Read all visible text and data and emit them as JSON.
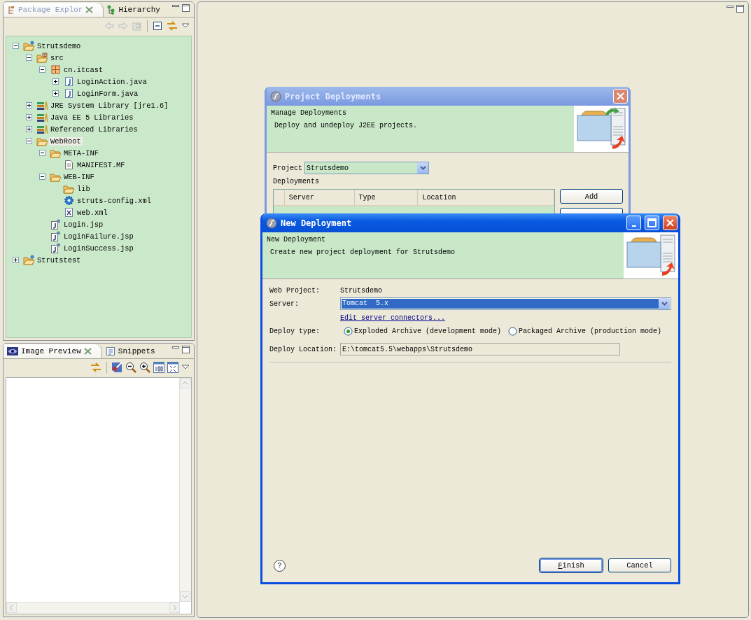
{
  "package_explorer": {
    "tabs": [
      {
        "label": "Package Explor",
        "selected": true
      },
      {
        "label": "Hierarchy",
        "selected": false
      }
    ],
    "tree": [
      {
        "label": "Strutsdemo",
        "kind": "project",
        "expanded": true,
        "selected": false,
        "children": [
          {
            "label": "src",
            "kind": "source-folder",
            "expanded": true,
            "selected": false,
            "children": [
              {
                "label": "cn.itcast",
                "kind": "package",
                "expanded": true,
                "selected": false,
                "children": [
                  {
                    "label": "LoginAction.java",
                    "kind": "java-file",
                    "expanded": false,
                    "selected": false
                  },
                  {
                    "label": "LoginForm.java",
                    "kind": "java-file",
                    "expanded": false,
                    "selected": false
                  }
                ]
              }
            ]
          },
          {
            "label": "JRE System Library [jre1.6]",
            "kind": "library",
            "expanded": false,
            "selected": false
          },
          {
            "label": "Java EE 5 Libraries",
            "kind": "library",
            "expanded": false,
            "selected": false
          },
          {
            "label": "Referenced Libraries",
            "kind": "library",
            "expanded": false,
            "selected": false
          },
          {
            "label": "WebRoot",
            "kind": "folder",
            "expanded": true,
            "selected": true,
            "children": [
              {
                "label": "META-INF",
                "kind": "folder",
                "expanded": true,
                "selected": false,
                "children": [
                  {
                    "label": "MANIFEST.MF",
                    "kind": "file",
                    "selected": false
                  }
                ]
              },
              {
                "label": "WEB-INF",
                "kind": "folder",
                "expanded": true,
                "selected": false,
                "children": [
                  {
                    "label": "lib",
                    "kind": "folder",
                    "selected": false
                  },
                  {
                    "label": "struts-config.xml",
                    "kind": "config-file",
                    "selected": false
                  },
                  {
                    "label": "web.xml",
                    "kind": "xml-file",
                    "selected": false
                  }
                ]
              },
              {
                "label": "Login.jsp",
                "kind": "jsp-file",
                "selected": false
              },
              {
                "label": "LoginFailure.jsp",
                "kind": "jsp-file",
                "selected": false
              },
              {
                "label": "LoginSuccess.jsp",
                "kind": "jsp-file",
                "selected": false
              }
            ]
          }
        ]
      },
      {
        "label": "Strutstest",
        "kind": "project",
        "expanded": false,
        "selected": false
      }
    ]
  },
  "image_preview": {
    "tabs": [
      {
        "label": "Image Preview",
        "selected": true
      },
      {
        "label": "Snippets",
        "selected": false
      }
    ]
  },
  "project_deployments": {
    "title": "Project Deployments",
    "header_title": "Manage Deployments",
    "header_description": "Deploy and undeploy J2EE projects.",
    "project_label": "Project",
    "project_value": "Strutsdemo",
    "deployments_label": "Deployments",
    "columns": [
      "Server",
      "Type",
      "Location"
    ],
    "add_button": "Add"
  },
  "new_deployment": {
    "title": "New Deployment",
    "header_title": "New Deployment",
    "header_description": "Create new project deployment for Strutsdemo",
    "web_project_label": "Web Project:",
    "web_project_value": "Strutsdemo",
    "server_label": "Server:",
    "server_value": "Tomcat  5.x",
    "link": "Edit server connectors...",
    "deploy_type_label": "Deploy type:",
    "deploy_types": [
      {
        "label": "Exploded Archive (development mode)",
        "selected": true
      },
      {
        "label": "Packaged Archive (production mode)",
        "selected": false
      }
    ],
    "location_label": "Deploy Location:",
    "location_value": "E:\\tomcat5.5\\webapps\\Strutsdemo",
    "help": "?",
    "buttons": [
      {
        "label": "Finish",
        "default": true
      },
      {
        "label": "Cancel",
        "default": false
      }
    ]
  }
}
